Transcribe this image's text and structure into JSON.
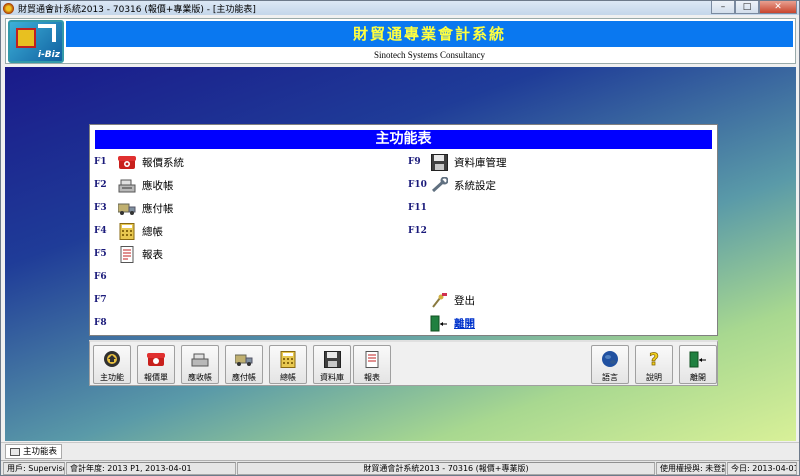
{
  "window": {
    "title": "財貿通會計系統2013 - 70316 (報價+專業版) - [主功能表]",
    "controls": {
      "minimize": "–",
      "maximize": "□",
      "close": "✕"
    }
  },
  "header": {
    "logo_text": "i-Biz",
    "banner": "財貿通專業會計系統",
    "subtitle": "Sinotech Systems Consultancy"
  },
  "menu": {
    "title": "主功能表",
    "left_items": [
      {
        "key": "F1",
        "label": "報價系統",
        "icon": "telephone-icon"
      },
      {
        "key": "F2",
        "label": "應收帳",
        "icon": "cash-register-icon"
      },
      {
        "key": "F3",
        "label": "應付帳",
        "icon": "truck-icon"
      },
      {
        "key": "F4",
        "label": "總帳",
        "icon": "calculator-icon"
      },
      {
        "key": "F5",
        "label": "報表",
        "icon": "report-icon"
      },
      {
        "key": "F6",
        "label": ""
      },
      {
        "key": "F7",
        "label": ""
      },
      {
        "key": "F8",
        "label": ""
      }
    ],
    "right_items": [
      {
        "key": "F9",
        "label": "資料庫管理",
        "icon": "floppy-disk-icon"
      },
      {
        "key": "F10",
        "label": "系統設定",
        "icon": "wrench-icon"
      },
      {
        "key": "F11",
        "label": ""
      },
      {
        "key": "F12",
        "label": ""
      }
    ],
    "login_label": "登出",
    "exit_label": "離開"
  },
  "toolbar": {
    "left_buttons": [
      {
        "label": "主功能",
        "icon": "home-icon"
      },
      {
        "label": "報價單",
        "icon": "telephone-icon"
      },
      {
        "label": "應收帳",
        "icon": "cash-register-icon"
      },
      {
        "label": "應付帳",
        "icon": "truck-icon"
      },
      {
        "label": "總帳",
        "icon": "calculator-icon"
      },
      {
        "label": "資料庫",
        "icon": "floppy-disk-icon"
      },
      {
        "label": "報表",
        "icon": "report-icon"
      }
    ],
    "right_buttons": [
      {
        "label": "語言",
        "icon": "globe-icon"
      },
      {
        "label": "說明",
        "icon": "help-icon"
      },
      {
        "label": "離開",
        "icon": "exit-door-icon"
      }
    ]
  },
  "taskbar": {
    "tab_label": "主功能表"
  },
  "statusbar": {
    "user": "用戶: Supervisor",
    "fiscal": "會計年度: 2013 P1, 2013-04-01",
    "app": "財貿通會計系統2013 - 70316 (報價+專業版)",
    "license": "使用權授與: 未登記",
    "today": "今日: 2013-04-01"
  }
}
